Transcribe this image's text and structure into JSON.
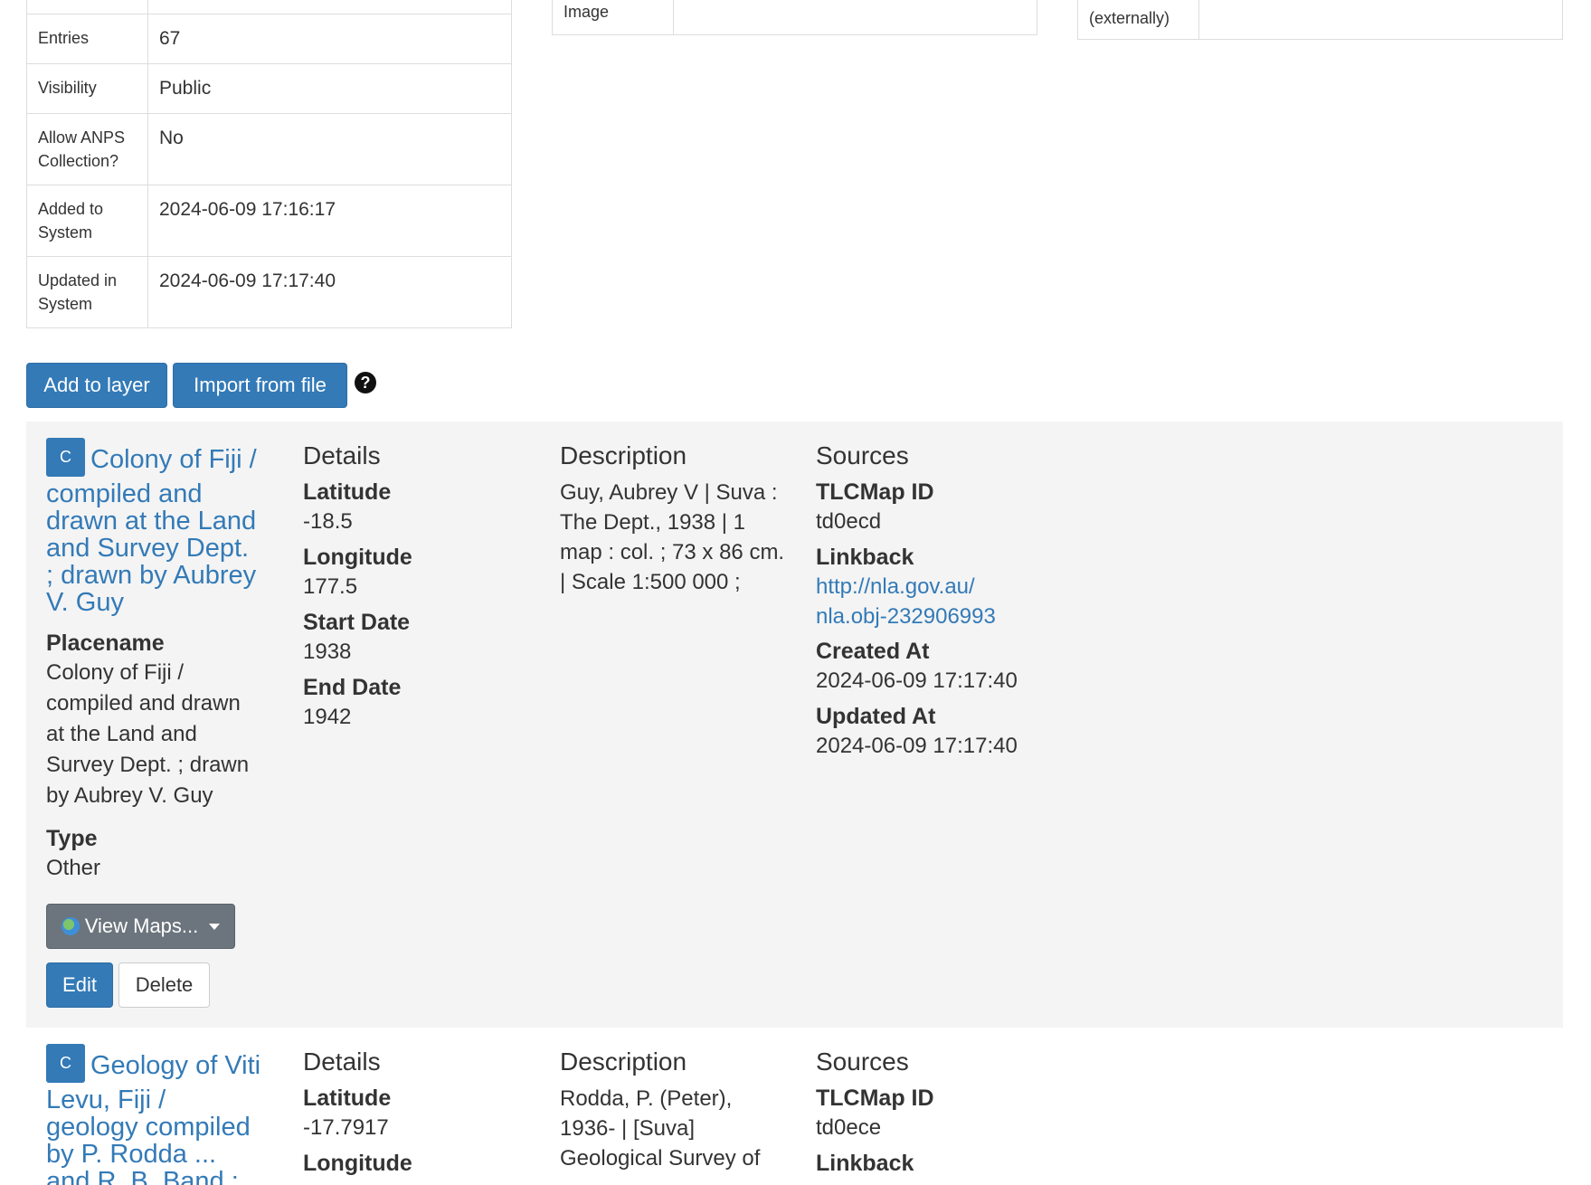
{
  "table_left": {
    "rows": [
      {
        "label": "",
        "value": ""
      },
      {
        "label": "Entries",
        "value": "67"
      },
      {
        "label": "Visibility",
        "value": "Public"
      },
      {
        "label": "Allow ANPS Collection?",
        "value": "No"
      },
      {
        "label": "Added to System",
        "value": "2024-06-09 17:16:17"
      },
      {
        "label": "Updated in System",
        "value": "2024-06-09 17:17:40"
      }
    ]
  },
  "table_mid": {
    "label": "Image",
    "value": ""
  },
  "table_right": {
    "label": "(externally)",
    "value": ""
  },
  "toolbar": {
    "add_label": "Add to layer",
    "import_label": "Import from file",
    "help_glyph": "?"
  },
  "entries": [
    {
      "badge": "C",
      "title": "Colony of Fiji / compiled and drawn at the Land and Survey Dept. ; drawn by Aubrey V. Guy",
      "placename_label": "Placename",
      "placename": "Colony of Fiji / compiled and drawn at the Land and Survey Dept. ; drawn by Aubrey V. Guy",
      "type_label": "Type",
      "type": "Other",
      "details_head": "Details",
      "lat_label": "Latitude",
      "lat": "-18.5",
      "lon_label": "Longitude",
      "lon": "177.5",
      "start_label": "Start Date",
      "start": "1938",
      "end_label": "End Date",
      "end": "1942",
      "desc_head": "Description",
      "description": "Guy, Aubrey V | Suva : The Dept., 1938 | 1 map : col. ; 73 x 86 cm. | Scale 1:500 000 ;",
      "sources_head": "Sources",
      "tlc_label": "TLCMap ID",
      "tlc": "td0ecd",
      "linkback_label": "Linkback",
      "linkback_line1": "http://nla.gov.au/",
      "linkback_line2": "nla.obj-232906993",
      "created_label": "Created At",
      "created": "2024-06-09 17:17:40",
      "updated_label": "Updated At",
      "updated": "2024-06-09 17:17:40",
      "viewmaps_label": "View Maps...",
      "edit_label": "Edit",
      "delete_label": "Delete"
    },
    {
      "badge": "C",
      "title": "Geology of Viti Levu, Fiji / geology compiled by P. Rodda ... and R. B. Band ; drawn by P.",
      "details_head": "Details",
      "lat_label": "Latitude",
      "lat": "-17.7917",
      "lon_label": "Longitude",
      "desc_head": "Description",
      "description": "Rodda, P. (Peter), 1936- | [Suva] Geological Survey of",
      "sources_head": "Sources",
      "tlc_label": "TLCMap ID",
      "tlc": "td0ece",
      "linkback_label": "Linkback"
    }
  ]
}
